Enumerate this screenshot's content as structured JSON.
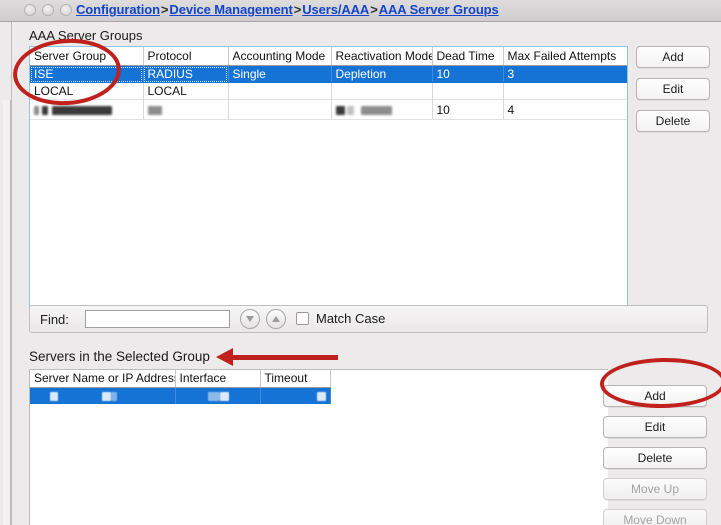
{
  "window": {
    "controls": [
      "close-button",
      "minimize-button",
      "zoom-button"
    ]
  },
  "breadcrumb": {
    "full": "Configuration > Device Management > Users/AAA > AAA Server Groups",
    "parts": [
      "Configuration",
      "Device Management",
      "Users/AAA",
      "AAA Server Groups"
    ],
    "separator": ">",
    "link_color": "#1245cb"
  },
  "aaa_section": {
    "title": "AAA Server Groups",
    "columns": [
      "Server Group",
      "Protocol",
      "Accounting Mode",
      "Reactivation Mode",
      "Dead Time",
      "Max Failed Attempts"
    ],
    "rows": [
      {
        "selected": true,
        "redacted": false,
        "server_group": "ISE",
        "protocol": "RADIUS",
        "accounting_mode": "Single",
        "reactivation_mode": "Depletion",
        "dead_time": "10",
        "max_failed_attempts": "3"
      },
      {
        "selected": false,
        "redacted": false,
        "server_group": "LOCAL",
        "protocol": "LOCAL",
        "accounting_mode": "",
        "reactivation_mode": "",
        "dead_time": "",
        "max_failed_attempts": ""
      },
      {
        "selected": false,
        "redacted": true,
        "server_group": "",
        "protocol": "",
        "accounting_mode": "",
        "reactivation_mode": "",
        "dead_time": "10",
        "max_failed_attempts": "4"
      }
    ],
    "buttons": [
      {
        "label": "Add",
        "enabled": true
      },
      {
        "label": "Edit",
        "enabled": true
      },
      {
        "label": "Delete",
        "enabled": true
      }
    ],
    "selection_color": "#1673d6"
  },
  "find_bar": {
    "label": "Find:",
    "value": "",
    "placeholder": "",
    "next_icon": "chevron-down-circle-icon",
    "prev_icon": "chevron-up-circle-icon",
    "match_case_label": "Match Case",
    "match_case_checked": false
  },
  "servers_section": {
    "title": "Servers in the Selected Group",
    "columns": [
      "Server Name or IP Address",
      "Interface",
      "Timeout"
    ],
    "rows": [
      {
        "selected": true,
        "redacted": true,
        "server_name_or_ip": "",
        "interface": "",
        "timeout": ""
      }
    ],
    "buttons": [
      {
        "label": "Add",
        "enabled": true
      },
      {
        "label": "Edit",
        "enabled": true
      },
      {
        "label": "Delete",
        "enabled": true
      },
      {
        "label": "Move Up",
        "enabled": false
      },
      {
        "label": "Move Down",
        "enabled": false
      }
    ]
  },
  "annotations": {
    "marker_color": "#c0211c",
    "ellipse_server_group": "red-ellipse-around-server-group-column",
    "ellipse_add_button": "red-ellipse-around-servers-add-button",
    "arrow_servers_title": "red-arrow-pointing-left-to-servers-in-the-selected-group"
  }
}
